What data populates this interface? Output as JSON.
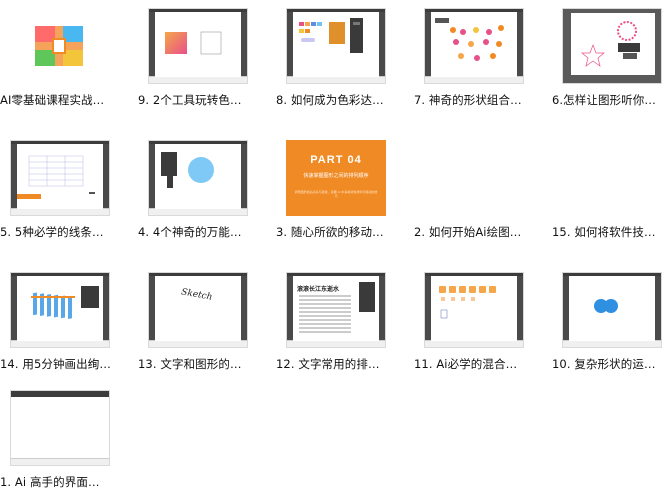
{
  "items": [
    {
      "label": "AI零基础课程实战…",
      "thumb": "folder-icon"
    },
    {
      "label": "9. 2个工具玩转色…",
      "thumb": "gradient-square"
    },
    {
      "label": "8. 如何成为色彩达…",
      "thumb": "color-panels"
    },
    {
      "label": "7. 神奇的形状组合…",
      "thumb": "shape-combos"
    },
    {
      "label": "6.怎样让图形听你…",
      "thumb": "star-shapes"
    },
    {
      "label": "5. 5种必学的线条…",
      "thumb": "line-grid"
    },
    {
      "label": "4. 4个神奇的万能…",
      "thumb": "blue-circle"
    },
    {
      "label": "3. 随心所欲的移动…",
      "thumb": "orange-title"
    },
    {
      "label": "2. 如何开始Ai绘图…",
      "thumb": "blank"
    },
    {
      "label": "15. 如何将软件技…",
      "thumb": "blank"
    },
    {
      "label": "14. 用5分钟画出绚…",
      "thumb": "blue-columns"
    },
    {
      "label": "13. 文字和图形的…",
      "thumb": "text-curve"
    },
    {
      "label": "12. 文字常用的排…",
      "thumb": "text-layout"
    },
    {
      "label": "11. Ai必学的混合…",
      "thumb": "blend-shapes"
    },
    {
      "label": "10. 复杂形状的运…",
      "thumb": "blue-blobs"
    },
    {
      "label": "1. Ai 高手的界面…",
      "thumb": "blank"
    }
  ],
  "orange_slide": {
    "title": "PART 04",
    "subtitle": "快速掌握图形之间的排列顺序",
    "caption": "调整图形前后关系与层级，掌握 Ai 中多种对象排列与移动的技巧"
  },
  "text_layout": {
    "heading": "滚滚长江东逝水"
  },
  "text_curve": {
    "word": "Sketch"
  },
  "colors": {
    "orange": "#f08a24",
    "blue": "#7ec9f5",
    "pink": "#e8508a",
    "dark": "#3a3a3a"
  }
}
